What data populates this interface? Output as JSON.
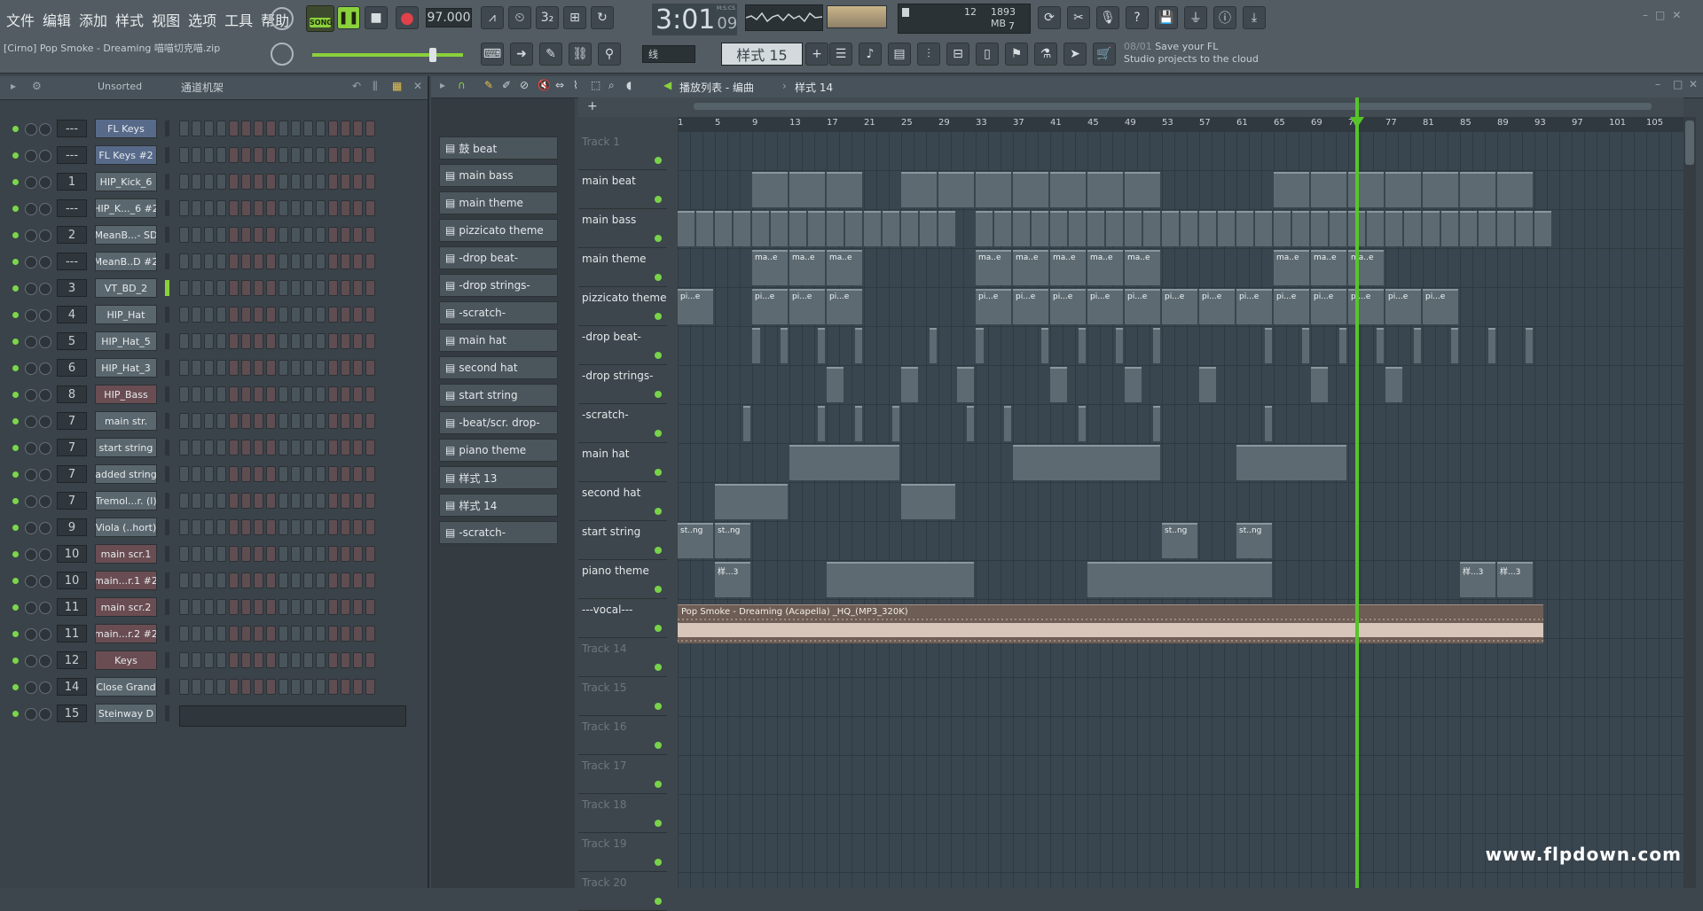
{
  "menu": [
    "文件",
    "编辑",
    "添加",
    "样式",
    "视图",
    "选项",
    "工具",
    "帮助"
  ],
  "transport": {
    "mode": "SONG",
    "tempo": "97.000",
    "time": "3:01",
    "time_sub": "09",
    "time_label": "M:S:CS"
  },
  "monitor": {
    "cpu": "12",
    "memory": "1893 MB",
    "poly": "7"
  },
  "project_hint": "[Cirno] Pop Smoke - Dreaming 喵喵切克喵.zip",
  "snap": "线",
  "pattern_selector": "样式 15",
  "news": {
    "date": "08/01",
    "line1": "Save your FL",
    "line2": "Studio projects to the cloud"
  },
  "rack": {
    "filter": "Unsorted",
    "title": "通道机架"
  },
  "channels": [
    {
      "num": "---",
      "name": "FL Keys",
      "style": "hl"
    },
    {
      "num": "---",
      "name": "FL Keys #2",
      "style": "hl"
    },
    {
      "num": "1",
      "name": "HIP_Kick_6",
      "style": ""
    },
    {
      "num": "---",
      "name": "HIP_K..._6 #2",
      "style": ""
    },
    {
      "num": "2",
      "name": "MeanB...- SD",
      "style": ""
    },
    {
      "num": "---",
      "name": "MeanB..D #2",
      "style": ""
    },
    {
      "num": "3",
      "name": "VT_BD_2",
      "style": ""
    },
    {
      "num": "4",
      "name": "HIP_Hat",
      "style": ""
    },
    {
      "num": "5",
      "name": "HIP_Hat_5",
      "style": ""
    },
    {
      "num": "6",
      "name": "HIP_Hat_3",
      "style": ""
    },
    {
      "num": "8",
      "name": "HIP_Bass",
      "style": "red"
    },
    {
      "num": "7",
      "name": "main str.",
      "style": ""
    },
    {
      "num": "7",
      "name": "start string",
      "style": ""
    },
    {
      "num": "7",
      "name": "added string",
      "style": ""
    },
    {
      "num": "7",
      "name": "Tremol...r. (l)",
      "style": ""
    },
    {
      "num": "9",
      "name": "Viola (..hort)",
      "style": ""
    },
    {
      "num": "10",
      "name": "main scr.1",
      "style": "red"
    },
    {
      "num": "10",
      "name": "main...r.1 #2",
      "style": "red"
    },
    {
      "num": "11",
      "name": "main scr.2",
      "style": "red"
    },
    {
      "num": "11",
      "name": "main...r.2 #2",
      "style": "red"
    },
    {
      "num": "12",
      "name": "Keys",
      "style": "red"
    },
    {
      "num": "14",
      "name": "Close Grand",
      "style": ""
    },
    {
      "num": "15",
      "name": "Steinway D",
      "style": ""
    }
  ],
  "patterns": [
    "鼓 beat",
    "main bass",
    "main theme",
    "pizzicato theme",
    "-drop beat-",
    "-drop strings-",
    "-scratch-",
    "main hat",
    "second hat",
    "start string",
    "-beat/scr. drop-",
    "piano theme",
    "样式 13",
    "样式 14",
    "-scratch-"
  ],
  "playlist": {
    "title": "播放列表 - 编曲",
    "crumb": "样式 14"
  },
  "tracks": [
    "Track 1",
    "main beat",
    "main bass",
    "main theme",
    "pizzicato theme",
    "-drop beat-",
    "-drop strings-",
    "-scratch-",
    "main hat",
    "second hat",
    "start string",
    "piano theme",
    "---vocal---",
    "Track 14",
    "Track 15",
    "Track 16",
    "Track 17",
    "Track 18",
    "Track 19",
    "Track 20"
  ],
  "ruler_marks": [
    "1",
    "5",
    "9",
    "13",
    "17",
    "21",
    "25",
    "29",
    "33",
    "37",
    "41",
    "45",
    "49",
    "53",
    "57",
    "61",
    "65",
    "69",
    "73",
    "77",
    "81",
    "85",
    "89",
    "93",
    "97",
    "101",
    "105"
  ],
  "vocal_clip": "Pop Smoke - Dreaming (Acapella) _HQ_(MP3_320K)",
  "clip_labels": {
    "theme": "ma..e",
    "pizz": "pi...e",
    "string": "st..ng",
    "piano": "样...3"
  },
  "watermark": "www.flpdown.com"
}
